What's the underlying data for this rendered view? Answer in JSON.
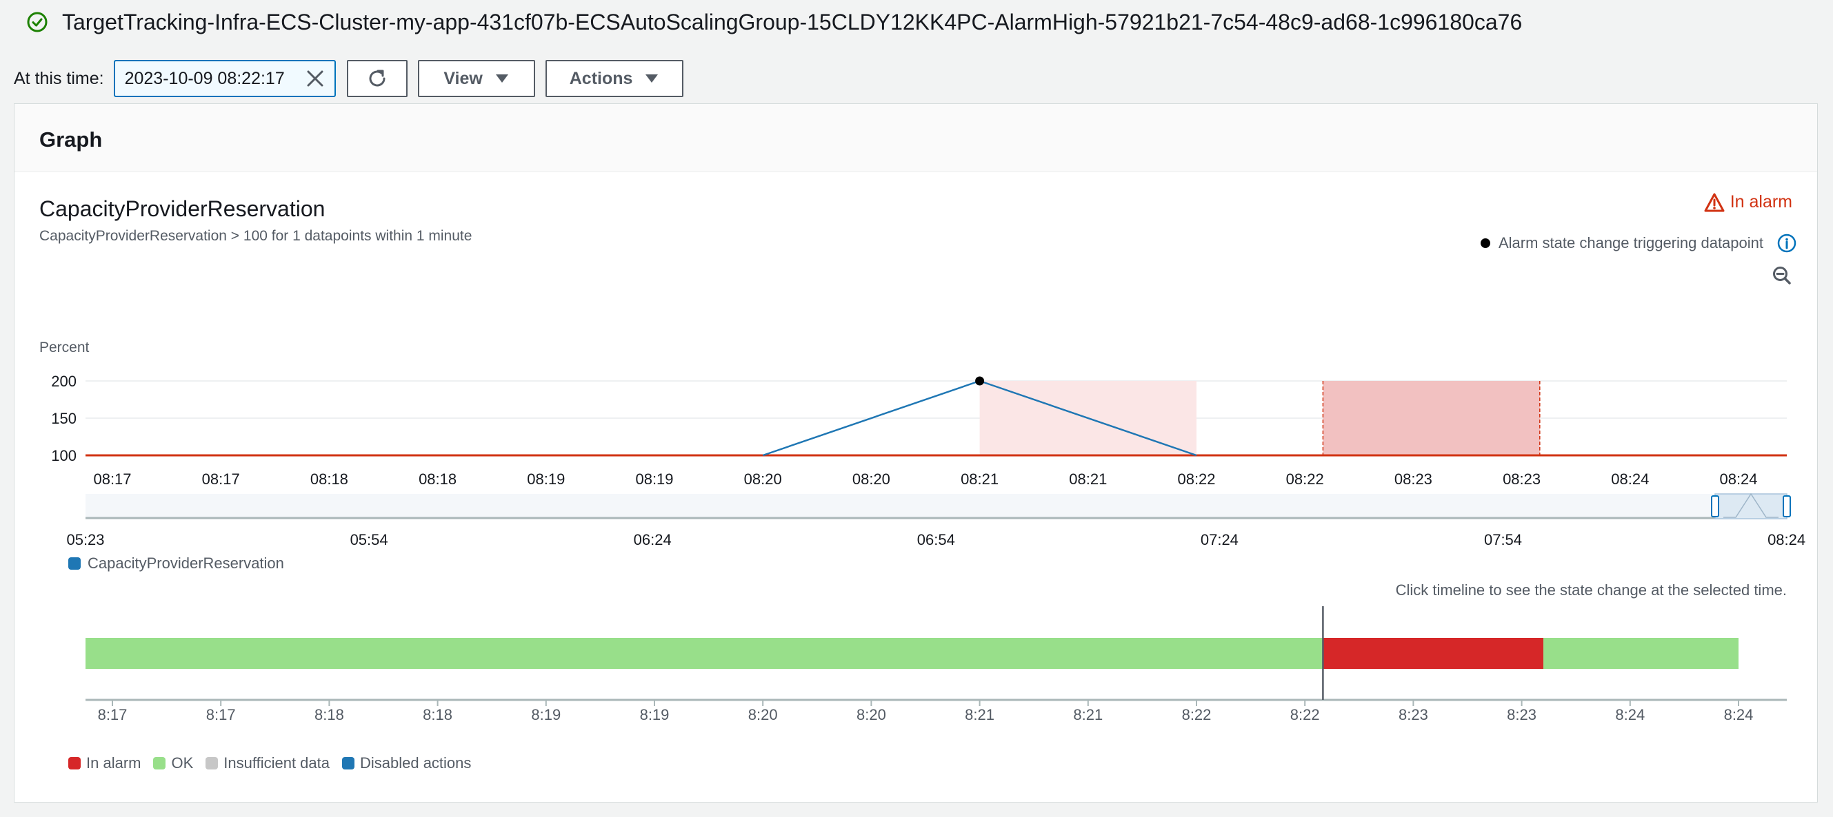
{
  "header": {
    "status": "ok",
    "title": "TargetTracking-Infra-ECS-Cluster-my-app-431cf07b-ECSAutoScalingGroup-15CLDY12KK4PC-AlarmHigh-57921b21-7c54-48c9-ad68-1c996180ca76"
  },
  "toolbar": {
    "at_label": "At this time:",
    "time_value": "2023-10-09 08:22:17",
    "view_label": "View",
    "actions_label": "Actions"
  },
  "panel": {
    "header": "Graph",
    "metric_name": "CapacityProviderReservation",
    "metric_description": "CapacityProviderReservation > 100 for 1 datapoints within 1 minute",
    "alarm_state_label": "In alarm",
    "trigger_legend": "Alarm state change triggering datapoint",
    "y_unit": "Percent",
    "series_legend": "CapacityProviderReservation",
    "timeline_hint": "Click timeline to see the state change at the selected time."
  },
  "chart_data": {
    "type": "line",
    "ylabel": "Percent",
    "y_ticks": [
      200,
      150,
      100
    ],
    "ylim": [
      100,
      200
    ],
    "x_tick_labels": [
      "08:17",
      "08:17",
      "08:18",
      "08:18",
      "08:19",
      "08:19",
      "08:20",
      "08:20",
      "08:21",
      "08:21",
      "08:22",
      "08:22",
      "08:23",
      "08:23",
      "08:24",
      "08:24"
    ],
    "series": [
      {
        "name": "CapacityProviderReservation",
        "color": "#1f77b4",
        "points": [
          {
            "x": "08:20",
            "y": 100
          },
          {
            "x": "08:21",
            "y": 200
          },
          {
            "x": "08:22",
            "y": 100
          }
        ]
      }
    ],
    "threshold": {
      "value": 100,
      "color": "#d13212"
    },
    "trigger_point": {
      "x": "08:21",
      "y": 200
    },
    "alarm_bands": [
      {
        "from": "08:21",
        "to": "08:22",
        "style": "light"
      },
      {
        "from": "08:22:35",
        "to": "08:23:35",
        "style": "dark"
      }
    ],
    "overview_axis_labels": [
      "05:23",
      "05:54",
      "06:24",
      "06:54",
      "07:24",
      "07:54",
      "08:24"
    ],
    "legend_placement": "bottom-left",
    "grid": true
  },
  "timeline": {
    "tick_labels": [
      "8:17",
      "8:17",
      "8:18",
      "8:18",
      "8:19",
      "8:19",
      "8:20",
      "8:20",
      "8:21",
      "8:21",
      "8:22",
      "8:22",
      "8:23",
      "8:23",
      "8:24",
      "8:24"
    ],
    "segments": [
      {
        "state": "OK",
        "from": "08:16:50",
        "to": "08:22:35"
      },
      {
        "state": "In alarm",
        "from": "08:22:35",
        "to": "08:23:36"
      },
      {
        "state": "OK",
        "from": "08:23:36",
        "to": "08:24:30"
      }
    ],
    "selected_time": "08:22:35",
    "colors": {
      "alarm": "#d62728",
      "ok": "#98df8a",
      "insufficient": "#c7c7c7",
      "disabled": "#1f77b4"
    }
  },
  "state_legend": [
    {
      "label": "In alarm",
      "color": "#d62728"
    },
    {
      "label": "OK",
      "color": "#98df8a"
    },
    {
      "label": "Insufficient data",
      "color": "#c7c7c7"
    },
    {
      "label": "Disabled actions",
      "color": "#1f77b4"
    }
  ]
}
